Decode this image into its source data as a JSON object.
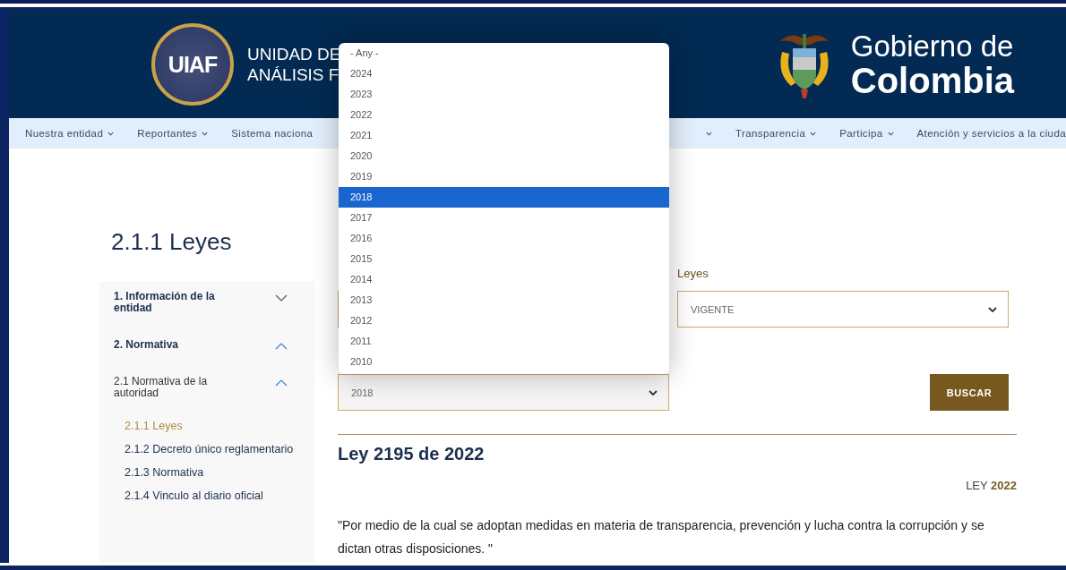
{
  "header": {
    "logo_text": "UIAF",
    "unit_name_lines": [
      "UNIDAD DE",
      "ANÁLISIS F"
    ],
    "gov_lines": [
      "Gobierno de",
      "Colombia"
    ]
  },
  "nav": [
    {
      "label": "Nuestra entidad",
      "caret": true
    },
    {
      "label": "Reportantes",
      "caret": true
    },
    {
      "label": "Sistema naciona",
      "caret": false
    },
    {
      "caret": true
    },
    {
      "label": "Transparencia",
      "caret": true
    },
    {
      "label": "Participa",
      "caret": true
    },
    {
      "label": "Atención y servicios a la ciuda",
      "caret": false
    }
  ],
  "page_title": "2.1.1 Leyes",
  "sidebar": {
    "items": [
      {
        "label": "1. Información de la entidad",
        "expanded": false
      },
      {
        "label": "2. Normativa",
        "expanded": true,
        "children": [
          {
            "label": "2.1 Normativa de la autoridad",
            "expanded": true,
            "children": [
              {
                "label": "2.1.1 Leyes",
                "selected": true
              },
              {
                "label": "2.1.2 Decreto único reglamentario",
                "selected": false
              },
              {
                "label": "2.1.3 Normativa",
                "selected": false
              },
              {
                "label": "2.1.4 Vinculo al diario oficial",
                "selected": false
              }
            ]
          }
        ]
      }
    ]
  },
  "filters": {
    "law_label": "Leyes",
    "law_value": "VIGENTE",
    "year_value": "2018",
    "search_button": "BUSCAR",
    "year_options": [
      {
        "label": "- Any -",
        "selected": false
      },
      {
        "label": "2024",
        "selected": false
      },
      {
        "label": "2023",
        "selected": false
      },
      {
        "label": "2022",
        "selected": false
      },
      {
        "label": "2021",
        "selected": false
      },
      {
        "label": "2020",
        "selected": false
      },
      {
        "label": "2019",
        "selected": false
      },
      {
        "label": "2018",
        "selected": true
      },
      {
        "label": "2017",
        "selected": false
      },
      {
        "label": "2016",
        "selected": false
      },
      {
        "label": "2015",
        "selected": false
      },
      {
        "label": "2014",
        "selected": false
      },
      {
        "label": "2013",
        "selected": false
      },
      {
        "label": "2012",
        "selected": false
      },
      {
        "label": "2011",
        "selected": false
      },
      {
        "label": "2010",
        "selected": false
      }
    ]
  },
  "result": {
    "title": "Ley 2195 de 2022",
    "type_label": "LEY",
    "year": "2022",
    "description": "\"Por medio de la cual se adoptan medidas en materia de transparencia, prevención y lucha contra la corrupción y se dictan otras disposiciones. \""
  }
}
